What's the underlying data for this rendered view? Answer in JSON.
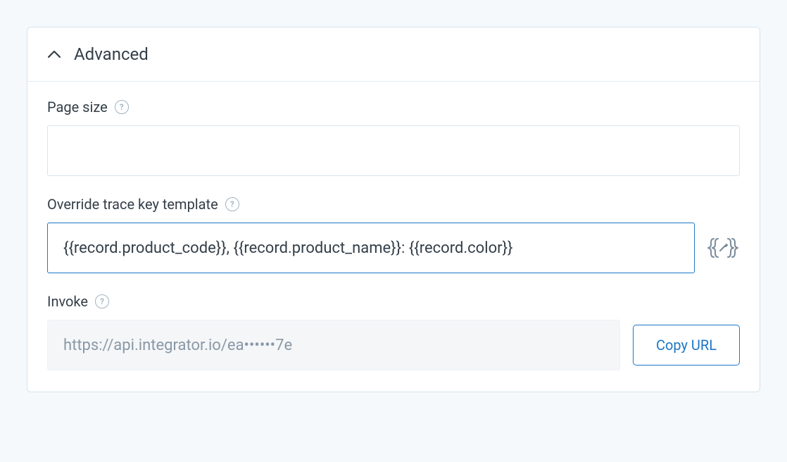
{
  "panel": {
    "title": "Advanced"
  },
  "fields": {
    "pageSize": {
      "label": "Page size",
      "value": ""
    },
    "traceKey": {
      "label": "Override trace key template",
      "value": "{{record.product_code}}, {{record.product_name}}: {{record.color}}"
    },
    "invoke": {
      "label": "Invoke",
      "value": "https://api.integrator.io/ea••••••7e",
      "copyButton": "Copy URL"
    }
  },
  "help_glyph": "?"
}
